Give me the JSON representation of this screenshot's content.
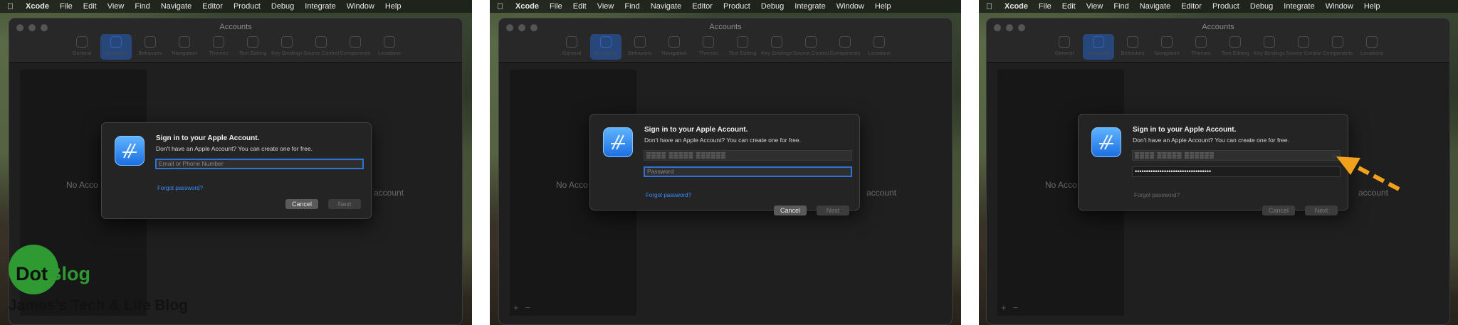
{
  "menubar": {
    "app": "Xcode",
    "items": [
      "File",
      "Edit",
      "View",
      "Find",
      "Navigate",
      "Editor",
      "Product",
      "Debug",
      "Integrate",
      "Window",
      "Help"
    ]
  },
  "window": {
    "title": "Accounts",
    "tabs": [
      "General",
      "Accounts",
      "Behaviors",
      "Navigation",
      "Themes",
      "Text Editing",
      "Key Bindings",
      "Source Control",
      "Components",
      "Locations"
    ],
    "active_tab": "Accounts",
    "no_accounts_left": "No Acco",
    "no_accounts_right": "account",
    "add_symbol": "+",
    "remove_symbol": "−"
  },
  "dialog": {
    "title": "Sign in to your Apple Account.",
    "subtitle": "Don't have an Apple Account? You can create one for free.",
    "email_placeholder": "Email or Phone Number",
    "password_placeholder": "Password",
    "password_masked": "••••••••••••••••••••••••••••••••••",
    "forgot": "Forgot password?",
    "cancel": "Cancel",
    "next": "Next"
  },
  "watermark": {
    "brand_a": "Dot",
    "brand_b": "Blog",
    "tagline": "James's Tech & Life Blog"
  },
  "colors": {
    "accent": "#2e74d6",
    "link": "#3a8cff",
    "arrow": "#f2a21a",
    "logo": "#2f9a31"
  }
}
